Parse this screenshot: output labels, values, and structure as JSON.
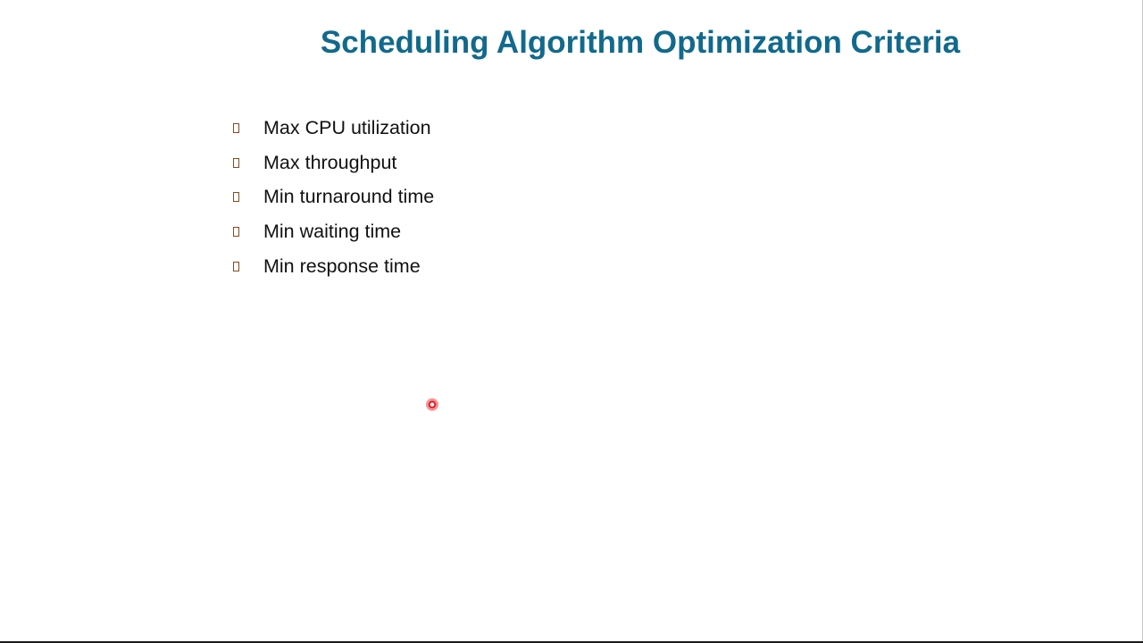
{
  "slide": {
    "title": "Scheduling Algorithm Optimization Criteria",
    "title_color": "#116a8c",
    "bullet_color": "#8a4a1c",
    "bullets": [
      "Max CPU utilization",
      "Max throughput",
      "Min turnaround time",
      "Min waiting time",
      "Min response time"
    ]
  },
  "pointer": {
    "icon": "laser-pointer-icon",
    "color": "#e0202a"
  }
}
